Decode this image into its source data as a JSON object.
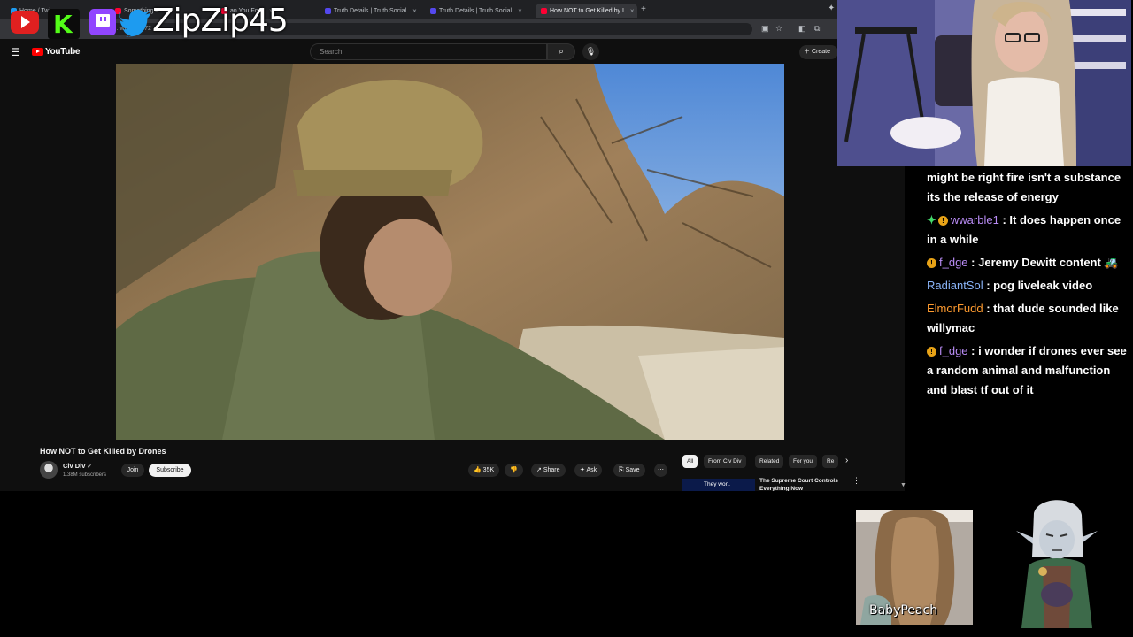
{
  "browser": {
    "tabs": [
      {
        "label": "Home / Twi",
        "favicon_color": "#1d9bf0"
      },
      {
        "label": "Something A",
        "favicon_color": "#ff0033"
      },
      {
        "label": "an You Fool",
        "favicon_color": "#ff0033"
      },
      {
        "label": "Truth Details | Truth Social",
        "favicon_color": "#5448ee"
      },
      {
        "label": "Truth Details | Truth Social",
        "favicon_color": "#5448ee"
      },
      {
        "label": "How NOT to Get Killed by I",
        "favicon_color": "#ff0033"
      }
    ],
    "address_fragment": "tub... watch...c72"
  },
  "overlay": {
    "handle": "ZipZip45",
    "icons": [
      "youtube-icon",
      "kick-icon",
      "twitch-icon",
      "twitter-icon"
    ]
  },
  "youtube": {
    "brand": "YouTube",
    "search_placeholder": "Search",
    "create_label": "Create",
    "video_title": "How NOT to Get Killed by Drones",
    "channel_name": "Civ Div",
    "subscriber_count": "1.38M subscribers",
    "join_label": "Join",
    "subscribe_label": "Subscribe",
    "likes": "35K",
    "share_label": "Share",
    "ask_label": "Ask",
    "save_label": "Save",
    "chips": [
      "All",
      "From Civ Div",
      "Related",
      "For you",
      "Re"
    ],
    "rec_thumb_text": "They won.",
    "rec_title": "The Supreme Court Controls Everything Now"
  },
  "chat": [
    {
      "user": "",
      "message": "might be right fire isn't a substance its the release of energy",
      "color": "#ffffff"
    },
    {
      "user": "wwarble1",
      "message": ": It does happen once in a while",
      "color": "#b98cf5",
      "badges": [
        "gem",
        "sub"
      ]
    },
    {
      "user": "f_dge",
      "message": ": Jeremy Dewitt content 🚜",
      "color": "#b98cf5",
      "badges": [
        "sub"
      ]
    },
    {
      "user": "RadiantSol",
      "message": ": pog liveleak video",
      "color": "#8ab4f8",
      "badges": []
    },
    {
      "user": "ElmorFudd",
      "message": ": that dude sounded like willymac",
      "color": "#ff9b2f",
      "badges": []
    },
    {
      "user": "f_dge",
      "message": ": i wonder if drones ever see a random animal and malfunction and blast tf out of it",
      "color": "#b98cf5",
      "badges": [
        "sub"
      ]
    }
  ],
  "guest": {
    "name": "BabyPeach"
  }
}
